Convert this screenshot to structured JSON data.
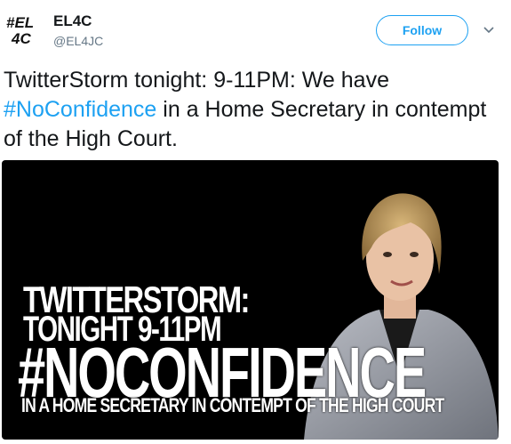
{
  "user": {
    "avatar_text": "#EL4C",
    "display_name": "EL4C",
    "handle": "@EL4JC"
  },
  "actions": {
    "follow_label": "Follow",
    "accent_color": "#1da1f2"
  },
  "tweet": {
    "text_part1": "TwitterStorm tonight: 9-11PM: We have ",
    "hashtag": "#NoConfidence",
    "text_part2": " in a Home Secretary in contempt of the High Court."
  },
  "media": {
    "line1": "TWITTERSTORM:",
    "line2": "TONIGHT 9-11PM",
    "line3": "#NOCONFIDENCE",
    "line4": "IN A HOME SECRETARY IN CONTEMPT OF THE HIGH COURT"
  }
}
